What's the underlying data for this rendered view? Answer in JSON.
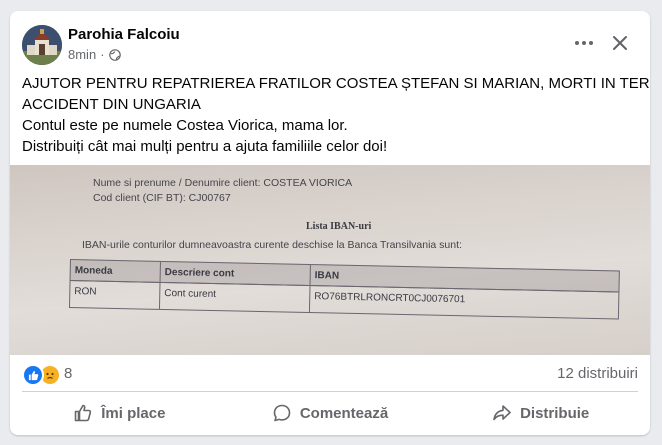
{
  "post": {
    "page_name": "Parohia Falcoiu",
    "time": "8min",
    "audience_icon": "globe-icon",
    "text_lines": [
      "AJUTOR PENTRU REPATRIEREA FRATILOR COSTEA ȘTEFAN SI MARIAN, MORTI IN TERIBILUL",
      "ACCIDENT DIN UNGARIA",
      "Contul este pe numele Costea Viorica,  mama lor.",
      "Distribuiți cât mai mulți pentru a ajuta familiile celor doi!"
    ]
  },
  "photo": {
    "client_name": "Nume si prenume / Denumire client: COSTEA VIORICA",
    "client_code": "Cod client (CIF BT): CJ00767",
    "list_title": "Lista IBAN-uri",
    "intro": "IBAN-urile conturilor dumneavoastra curente deschise la Banca Transilvania sunt:",
    "table": {
      "headers": [
        "Moneda",
        "Descriere cont",
        "IBAN"
      ],
      "rows": [
        [
          "RON",
          "Cont curent",
          "RO76BTRLRONCRT0CJ0076701"
        ]
      ]
    }
  },
  "stats": {
    "reaction_icons": [
      "like-icon",
      "sad-icon"
    ],
    "reaction_count": "8",
    "shares": "12 distribuiri"
  },
  "actions": {
    "like": "Îmi place",
    "comment": "Comentează",
    "share": "Distribuie"
  },
  "colors": {
    "like_blue": "#1877f2",
    "sad_yellow": "#f7b125",
    "secondary_text": "#65676b"
  }
}
